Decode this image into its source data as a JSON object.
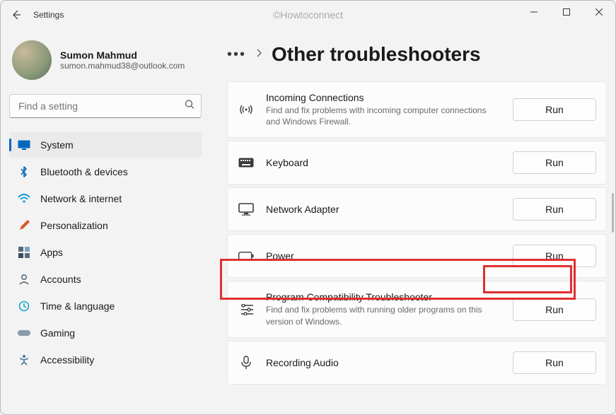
{
  "app_title": "Settings",
  "watermark": "©Howtoconnect",
  "profile": {
    "name": "Sumon Mahmud",
    "email": "sumon.mahmud38@outlook.com"
  },
  "search": {
    "placeholder": "Find a setting"
  },
  "nav": [
    {
      "label": "System",
      "icon": "system"
    },
    {
      "label": "Bluetooth & devices",
      "icon": "bluetooth"
    },
    {
      "label": "Network & internet",
      "icon": "wifi"
    },
    {
      "label": "Personalization",
      "icon": "brush"
    },
    {
      "label": "Apps",
      "icon": "apps"
    },
    {
      "label": "Accounts",
      "icon": "accounts"
    },
    {
      "label": "Time & language",
      "icon": "time"
    },
    {
      "label": "Gaming",
      "icon": "gaming"
    },
    {
      "label": "Accessibility",
      "icon": "accessibility"
    }
  ],
  "breadcrumb": {
    "more": "•••",
    "title": "Other troubleshooters"
  },
  "run_label": "Run",
  "troubleshooters": [
    {
      "title": "Incoming Connections",
      "desc": "Find and fix problems with incoming computer connections and Windows Firewall.",
      "icon": "antenna"
    },
    {
      "title": "Keyboard",
      "desc": "",
      "icon": "keyboard"
    },
    {
      "title": "Network Adapter",
      "desc": "",
      "icon": "monitor"
    },
    {
      "title": "Power",
      "desc": "",
      "icon": "battery"
    },
    {
      "title": "Program Compatibility Troubleshooter",
      "desc": "Find and fix problems with running older programs on this version of Windows.",
      "icon": "compat"
    },
    {
      "title": "Recording Audio",
      "desc": "",
      "icon": "mic"
    }
  ]
}
